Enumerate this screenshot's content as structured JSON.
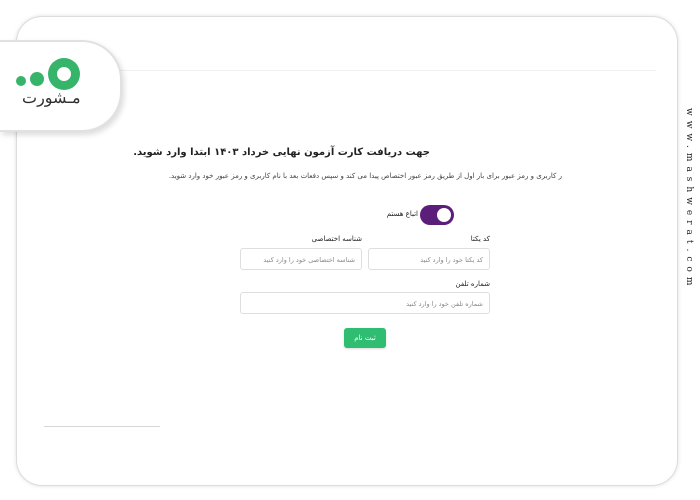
{
  "brand": {
    "logo_text": "مـشورت",
    "side_url": "www.mashwerat.com",
    "accent": "#35b46a"
  },
  "form": {
    "heading": "جهت دریافت کارت آزمون نهایی خرداد ۱۴۰۳ ابتدا وارد شوید.",
    "subtext": "ر کاربری و رمز عبور برای بار اول از طریق رمز عبور اختصاص پیدا می کند و سپس دفعات بعد با نام کاربری و رمز عبور خود وارد شوید.",
    "toggle_label": "اتباع هستم",
    "toggle_on": true,
    "fields": {
      "unique_code": {
        "label": "کد یکتا",
        "placeholder": "کد یکتا خود را وارد کنید"
      },
      "private_id": {
        "label": "شناسه اختصاصی",
        "placeholder": "شناسه اختصاصی خود را وارد کنید"
      },
      "phone": {
        "label": "شماره تلفن",
        "placeholder": "شماره تلفن خود را وارد کنید"
      }
    },
    "submit_label": "ثبت نام",
    "colors": {
      "toggle": "#5b1e7a",
      "submit": "#2ebd71"
    }
  }
}
